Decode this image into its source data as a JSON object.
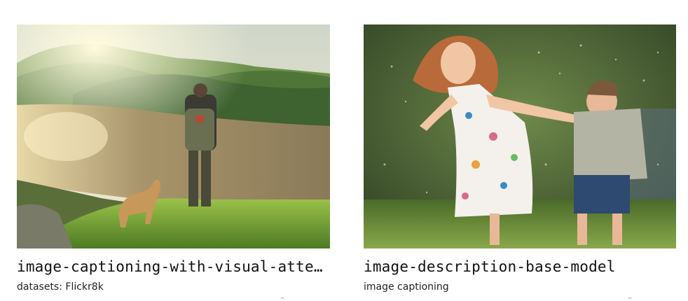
{
  "cards": [
    {
      "title": "image-captioning-with-visual-attent…",
      "subtitle": "datasets: Flickr8k",
      "image_alt": "hiker-with-dog-overlooking-lake"
    },
    {
      "title": "image-description-base-model",
      "subtitle": "image captioning",
      "image_alt": "children-running-through-sprinkler"
    }
  ]
}
